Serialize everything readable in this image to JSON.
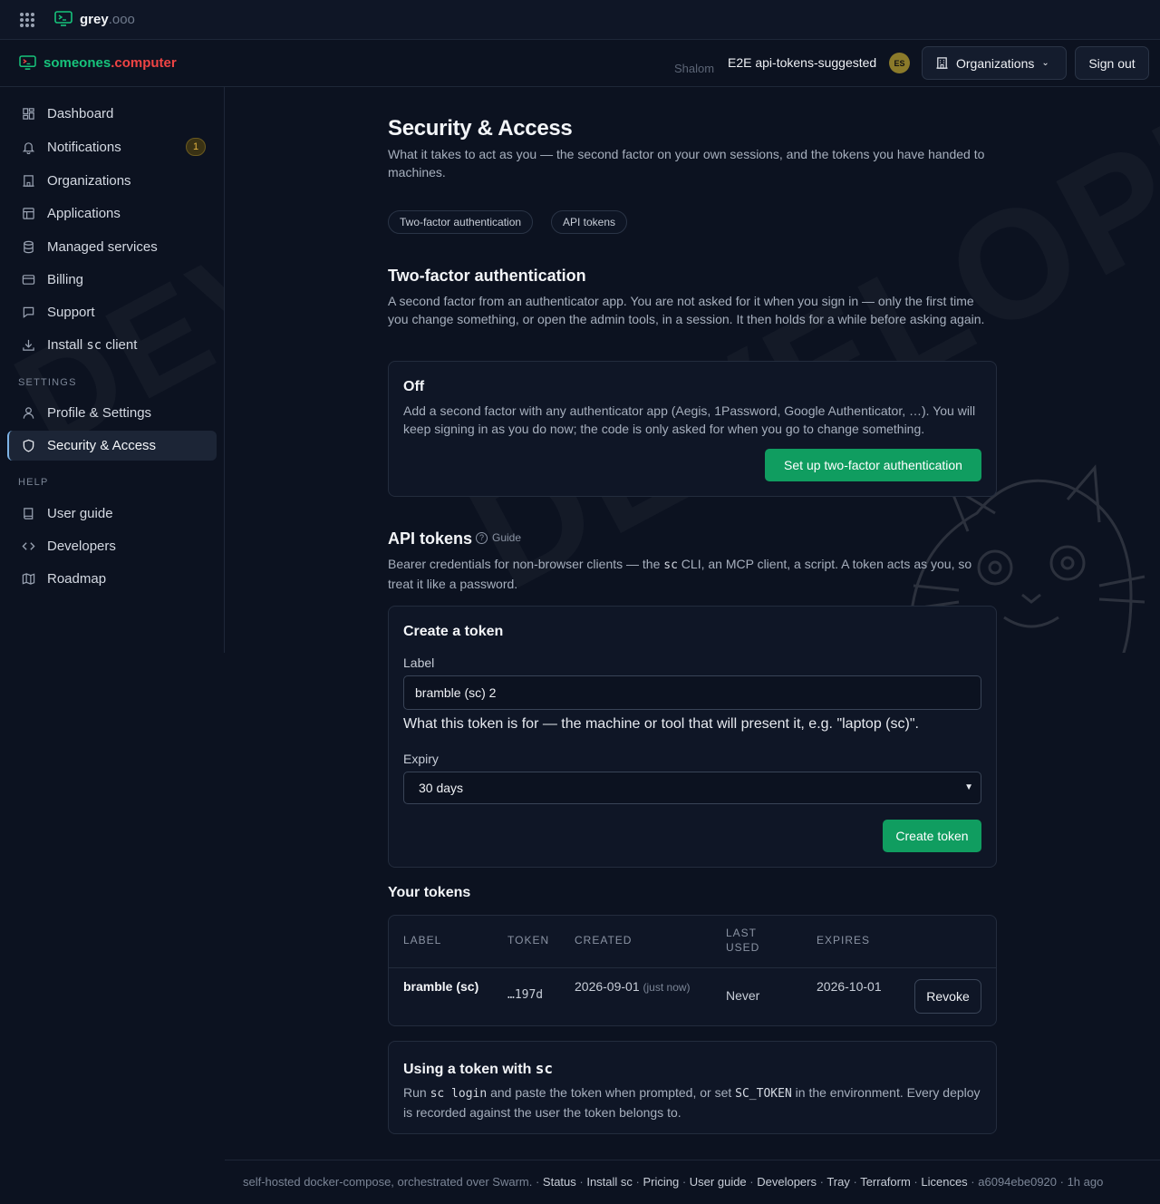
{
  "topbar": {
    "brand_name": "grey",
    "brand_tld": ".ooo"
  },
  "appbar": {
    "brand_name": "someones",
    "brand_tld": ".computer",
    "faded_name": "Shalom",
    "user_name": "E2E api-tokens-suggested",
    "avatar_initials": "ES",
    "organizations_label": "Organizations",
    "signout_label": "Sign out"
  },
  "sidebar": {
    "items": [
      {
        "label": "Dashboard",
        "icon": "dashboard-icon"
      },
      {
        "label": "Notifications",
        "icon": "bell-icon",
        "badge": "1"
      },
      {
        "label": "Organizations",
        "icon": "building-icon"
      },
      {
        "label": "Applications",
        "icon": "layout-icon"
      },
      {
        "label": "Managed services",
        "icon": "database-icon"
      },
      {
        "label": "Billing",
        "icon": "credit-card-icon"
      },
      {
        "label": "Support",
        "icon": "message-icon"
      },
      {
        "label": "Install ",
        "label_code": "sc",
        "label_suffix": " client",
        "icon": "download-icon"
      }
    ],
    "settings_label": "SETTINGS",
    "settings_items": [
      {
        "label": "Profile & Settings",
        "icon": "user-icon"
      },
      {
        "label": "Security & Access",
        "icon": "shield-icon",
        "active": true
      }
    ],
    "help_label": "HELP",
    "help_items": [
      {
        "label": "User guide",
        "icon": "book-icon"
      },
      {
        "label": "Developers",
        "icon": "code-icon"
      },
      {
        "label": "Roadmap",
        "icon": "map-icon"
      }
    ]
  },
  "watermark": {
    "text": "DEVELOPMENT"
  },
  "main": {
    "title": "Security & Access",
    "lead": "What it takes to act as you — the second factor on your own sessions, and the tokens you have handed to machines.",
    "pills": [
      "Two-factor authentication",
      "API tokens"
    ],
    "twofa": {
      "heading": "Two-factor authentication",
      "description": "A second factor from an authenticator app. You are not asked for it when you sign in — only the first time you change something, or open the admin tools, in a session. It then holds for a while before asking again.",
      "status": "Off",
      "status_text": "Add a second factor with any authenticator app (Aegis, 1Password, Google Authenticator, …). You will keep signing in as you do now; the code is only asked for when you go to change something.",
      "setup_button": "Set up two-factor authentication"
    },
    "api": {
      "heading": "API tokens",
      "guide_label": "Guide",
      "desc_pre": "Bearer credentials for non-browser clients — the ",
      "desc_code": "sc",
      "desc_post": " CLI, an MCP client, a script. A token acts as you, so treat it like a password.",
      "create": {
        "heading": "Create a token",
        "label_label": "Label",
        "label_value": "bramble (sc) 2",
        "label_help": "What this token is for — the machine or tool that will present it, e.g. \"laptop (sc)\".",
        "expiry_label": "Expiry",
        "expiry_value": "30 days",
        "create_button": "Create token"
      },
      "tokens_heading": "Your tokens",
      "table": {
        "headers": [
          "LABEL",
          "TOKEN",
          "CREATED",
          "LAST USED",
          "EXPIRES"
        ],
        "rows": [
          {
            "label": "bramble (sc)",
            "token": "…197d",
            "created": "2026-09-01",
            "created_note": "(just now)",
            "last_used": "Never",
            "expires": "2026-10-01",
            "action": "Revoke"
          }
        ]
      },
      "usage": {
        "heading_pre": "Using a token with ",
        "heading_code": "sc",
        "text_1": "Run ",
        "code_1": "sc login",
        "text_2": " and paste the token when prompted, or set ",
        "code_2": "SC_TOKEN",
        "text_3": " in the environment. Every deploy is recorded against the user the token belongs to."
      }
    }
  },
  "footer": {
    "lead": "self-hosted docker-compose, orchestrated over Swarm.",
    "links": [
      "Status",
      "Install sc",
      "Pricing",
      "User guide",
      "Developers",
      "Tray",
      "Terraform",
      "Licences"
    ],
    "commit": "a6094ebe0920",
    "age": "1h ago"
  }
}
